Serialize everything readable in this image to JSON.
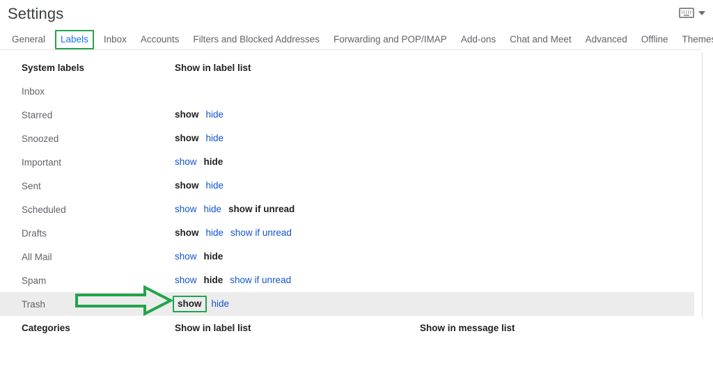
{
  "header": {
    "title": "Settings",
    "keyboard_icon": "keyboard-icon",
    "dropdown_icon": "chevron-down-icon"
  },
  "tabs": [
    {
      "label": "General",
      "active": false
    },
    {
      "label": "Labels",
      "active": true
    },
    {
      "label": "Inbox",
      "active": false
    },
    {
      "label": "Accounts",
      "active": false
    },
    {
      "label": "Filters and Blocked Addresses",
      "active": false
    },
    {
      "label": "Forwarding and POP/IMAP",
      "active": false
    },
    {
      "label": "Add-ons",
      "active": false
    },
    {
      "label": "Chat and Meet",
      "active": false
    },
    {
      "label": "Advanced",
      "active": false
    },
    {
      "label": "Offline",
      "active": false
    },
    {
      "label": "Themes",
      "active": false
    }
  ],
  "system_labels_section": {
    "name_header": "System labels",
    "label_list_header": "Show in label list",
    "rows": [
      {
        "name": "Inbox",
        "links": []
      },
      {
        "name": "Starred",
        "links": [
          {
            "text": "show",
            "state": "selected"
          },
          {
            "text": "hide",
            "state": "link"
          }
        ]
      },
      {
        "name": "Snoozed",
        "links": [
          {
            "text": "show",
            "state": "selected"
          },
          {
            "text": "hide",
            "state": "link"
          }
        ]
      },
      {
        "name": "Important",
        "links": [
          {
            "text": "show",
            "state": "link"
          },
          {
            "text": "hide",
            "state": "selected"
          }
        ]
      },
      {
        "name": "Sent",
        "links": [
          {
            "text": "show",
            "state": "selected"
          },
          {
            "text": "hide",
            "state": "link"
          }
        ]
      },
      {
        "name": "Scheduled",
        "links": [
          {
            "text": "show",
            "state": "link"
          },
          {
            "text": "hide",
            "state": "link"
          },
          {
            "text": "show if unread",
            "state": "selected"
          }
        ]
      },
      {
        "name": "Drafts",
        "links": [
          {
            "text": "show",
            "state": "selected"
          },
          {
            "text": "hide",
            "state": "link"
          },
          {
            "text": "show if unread",
            "state": "link"
          }
        ]
      },
      {
        "name": "All Mail",
        "links": [
          {
            "text": "show",
            "state": "link"
          },
          {
            "text": "hide",
            "state": "selected"
          }
        ]
      },
      {
        "name": "Spam",
        "links": [
          {
            "text": "show",
            "state": "link"
          },
          {
            "text": "hide",
            "state": "selected"
          },
          {
            "text": "show if unread",
            "state": "link"
          }
        ]
      },
      {
        "name": "Trash",
        "highlighted": true,
        "links": [
          {
            "text": "show",
            "state": "selected",
            "annotated": true
          },
          {
            "text": "hide",
            "state": "link"
          }
        ]
      }
    ]
  },
  "categories_section": {
    "name_header": "Categories",
    "label_list_header": "Show in label list",
    "message_list_header": "Show in message list"
  },
  "annotations": {
    "accent_color": "#22a44a",
    "arrow": "green-arrow-pointing-right",
    "boxed_tab": "Labels",
    "boxed_link": "show"
  },
  "colors": {
    "link_blue": "#1155cc",
    "tab_active_blue": "#1a73e8",
    "text_gray": "#5f6368",
    "text_dark": "#202124",
    "row_highlight": "#ececec",
    "annotation_green": "#22a44a"
  }
}
